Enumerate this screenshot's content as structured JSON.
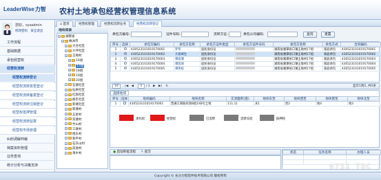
{
  "header": {
    "logo_text": "LeaderWise",
    "logo_cn": "力智",
    "system_title": "农村土地承包经营权管理信息系统"
  },
  "user": {
    "greeting": "您好，sysadmin",
    "links": [
      "修改密码",
      "安全退出"
    ]
  },
  "sidebar": {
    "items": [
      {
        "label": "工作流程",
        "level": 0
      },
      {
        "label": "基础数据",
        "level": 0
      },
      {
        "label": "承包经营权",
        "level": 0
      },
      {
        "label": "经营权流转",
        "level": 0,
        "active": true
      },
      {
        "label": "经营权流转登记",
        "level": 1,
        "active": true
      },
      {
        "label": "经营权流转变更登记",
        "level": 1
      },
      {
        "label": "经营权流转备案登记",
        "level": 1
      },
      {
        "label": "经营权流转注销登记",
        "level": 1
      },
      {
        "label": "经营权抵押管理",
        "level": 1
      },
      {
        "label": "经营权流转监督",
        "level": 1
      },
      {
        "label": "经营权市场管理",
        "level": 1
      },
      {
        "label": "纠纷调解仲裁",
        "level": 0
      },
      {
        "label": "档案资料管理",
        "level": 0
      },
      {
        "label": "业务查询",
        "level": 0
      },
      {
        "label": "统计分析与决策支持",
        "level": 0
      }
    ]
  },
  "tabs": [
    {
      "label": "首页",
      "active": false
    },
    {
      "label": "经营权管理",
      "active": false
    },
    {
      "label": "经营权流转业务",
      "active": false
    },
    {
      "label": "经营权流转登记",
      "active": true
    }
  ],
  "tree": {
    "title": "地块目录",
    "nodes": [
      {
        "label": "湖南省",
        "indent": 0
      },
      {
        "label": "株洲市",
        "indent": 1
      },
      {
        "label": "大合社区",
        "indent": 2
      },
      {
        "label": "沙坪社区",
        "indent": 2
      },
      {
        "label": "王坳村",
        "indent": 2
      },
      {
        "label": "16组",
        "indent": 3
      },
      {
        "label": "17组",
        "indent": 3,
        "selected": true
      },
      {
        "label": "18组",
        "indent": 3
      },
      {
        "label": "19组",
        "indent": 3
      },
      {
        "label": "20组",
        "indent": 3
      },
      {
        "label": "石塘社区",
        "indent": 2
      },
      {
        "label": "仙庾社区",
        "indent": 2
      },
      {
        "label": "红旗社区",
        "indent": 2
      },
      {
        "label": "群丰社区",
        "indent": 2
      },
      {
        "label": "新塘社区",
        "indent": 2
      },
      {
        "label": "新塘村",
        "indent": 2
      },
      {
        "label": "五星村",
        "indent": 2
      },
      {
        "label": "双塘村",
        "indent": 2
      },
      {
        "label": "竹山村",
        "indent": 2
      },
      {
        "label": "三联村",
        "indent": 2
      },
      {
        "label": "旭东村",
        "indent": 2
      },
      {
        "label": "和平村",
        "indent": 2
      },
      {
        "label": "石灰山村",
        "indent": 2
      },
      {
        "label": "前进村",
        "indent": 2
      },
      {
        "label": "清水村",
        "indent": 2
      }
    ]
  },
  "search": {
    "contractor_code_label": "承包方编号:",
    "certificate_label": "证件号码:",
    "org_label": "流转方证:",
    "company_label": "承包公司编码:",
    "query_button": "查询",
    "reset_button": "重置"
  },
  "grid": {
    "columns": [
      "序号",
      "选择",
      "承包方编码",
      "承包方名称",
      "承包方证件类型",
      "承包方证件号码",
      "发包方名称",
      "承包方式",
      "合同编码"
    ],
    "rows": [
      {
        "no": "1",
        "checked": false,
        "code": "430523101019170001",
        "name": "罗伟",
        "idtype": "居民身份证",
        "issuer": "湖南省湘潭县口镇王坳村17组",
        "method": "家庭承包",
        "contract": "430523101019170001"
      },
      {
        "no": "2",
        "checked": true,
        "code": "430523101019170002",
        "name": "大雄峰生",
        "idtype": "居民身份证",
        "issuer": "湖南省湘潭县口镇王坳村17组",
        "method": "家庭承包",
        "contract": "430523101019170002"
      },
      {
        "no": "3",
        "checked": false,
        "code": "430523101019170003",
        "name": "谭良湘",
        "idtype": "居民身份证",
        "issuer": "湖南省湘潭县口镇王坳村17组",
        "method": "家庭承包",
        "contract": "430523101019170003"
      },
      {
        "no": "4",
        "checked": false,
        "code": "430523101019170004",
        "name": "谭昌球",
        "idtype": "居民身份证",
        "issuer": "湖南省湘潭县口镇王坳村17组",
        "method": "家庭承包",
        "contract": "430523101019170004"
      },
      {
        "no": "5",
        "checked": false,
        "code": "430523101019170005",
        "name": "谭英松",
        "idtype": "居民身份证",
        "issuer": "湖南省湘潭县口镇王坳村17组",
        "method": "家庭承包",
        "contract": "430523101019170005"
      }
    ]
  },
  "pager": {
    "page_size": "10",
    "page": "1",
    "total_pages": "/ 1",
    "summary": "显示1到5, 共5条"
  },
  "land": {
    "tab_title": "选择地块",
    "columns": [
      "序号",
      "选择",
      "地块编码",
      "地块名称",
      "实测面积(亩)",
      "地块东至",
      "地块西至",
      "地块南至",
      "地块北至"
    ],
    "rows": [
      {
        "no": "1",
        "code": "430523101019170001",
        "name": "普通工商联农场8组1X8号土地",
        "area": "111.11",
        "east": "水1",
        "west": "西2",
        "south": "地4",
        "north": "地3"
      }
    ],
    "legend": [
      {
        "label": "承包权",
        "color": "#e01818"
      },
      {
        "label": "经营权",
        "color": "#e01818"
      },
      {
        "label": "已流转",
        "color": "#7a7a7a"
      },
      {
        "label": "流转冻结",
        "color": "#7a7a7a"
      },
      {
        "label": "抵押权",
        "color": "#7a7a7a"
      }
    ]
  },
  "actions": {
    "start_label": "启动审批流程",
    "submit_label": "提交"
  },
  "flow": {
    "columns": [
      "状态",
      "任务名称",
      "办理人员"
    ]
  },
  "footer": {
    "text": "Copyright © 长沙力智软件技术有限公司 版权所有"
  },
  "watermark": "0731 TDC"
}
